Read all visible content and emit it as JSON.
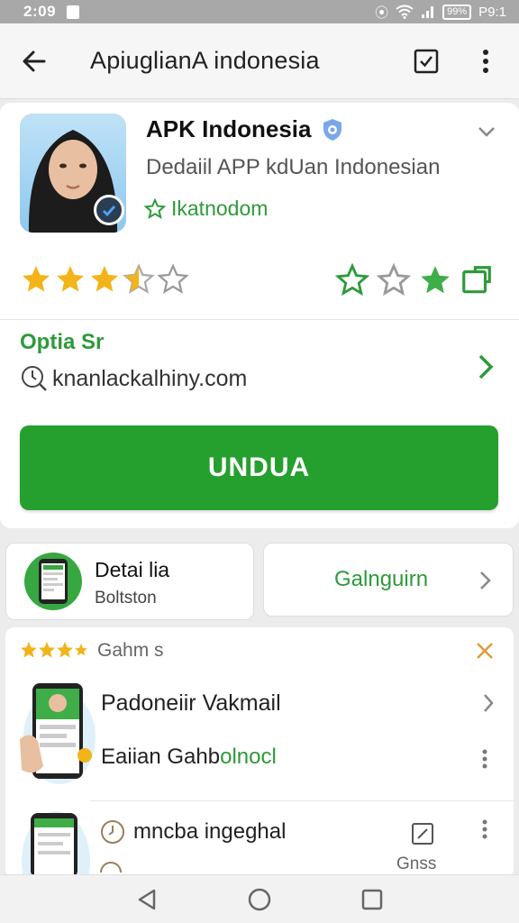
{
  "status_bar": {
    "time": "2:09",
    "battery": "99%",
    "right_text": "P9:1"
  },
  "app_bar": {
    "title": "ApiuglianA indonesia",
    "back_icon": "arrow-left-icon",
    "check_icon": "checkbox-icon",
    "menu_icon": "more-vert-icon"
  },
  "app_card": {
    "name": "APK Indonesia",
    "description": "Dedaiil APP kdUan Indonesian",
    "recommendation": "Ikatnodom",
    "rating_left": 3.5,
    "option_label": "Optia Sr",
    "website": "knanlackalhiny.com",
    "download_label": "UNDUA",
    "accent_color": "#25a02e"
  },
  "detail_card": {
    "title": "Detai lia",
    "subtitle": "Boltston"
  },
  "gallery_card": {
    "label": "Galnguirn"
  },
  "list_card": {
    "header": "Gahm s",
    "items": [
      {
        "title": "Padoneiir Vakmail",
        "subtitle_dark": "Eaiian Gahb",
        "subtitle_green": "olnocl"
      },
      {
        "title": "mncba ingeghal",
        "side_label": "Gnss"
      }
    ]
  }
}
